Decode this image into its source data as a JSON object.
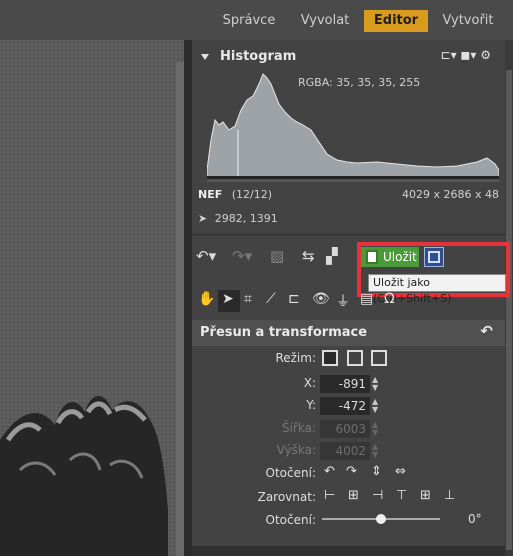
{
  "topnav": {
    "tabs": [
      {
        "label": "Správce"
      },
      {
        "label": "Vyvolat"
      },
      {
        "label": "Editor"
      },
      {
        "label": "Vytvořit"
      }
    ]
  },
  "histogram": {
    "title": "Histogram",
    "rgba": "RGBA:  35,  35,  35, 255"
  },
  "file": {
    "format": "NEF",
    "index": "(12/12)",
    "dimensions": "4029 x 2686 x 48",
    "cursor_pos": "2982, 1391"
  },
  "save": {
    "save_label": "Uložit",
    "tooltip": "Uložit jako (Ctrl+Shift+S)"
  },
  "section": {
    "title": "Přesun a transformace",
    "mode_label": "Režim:",
    "x_label": "X:",
    "x_value": "-891",
    "y_label": "Y:",
    "y_value": "-472",
    "width_label": "Šířka:",
    "width_value": "6003",
    "height_label": "Výška:",
    "height_value": "4002",
    "rotate_label": "Otočení:",
    "align_label": "Zarovnat:",
    "rotation_label": "Otočení:",
    "rotation_value": "0°",
    "rotation_slider": 0.5
  },
  "colors": {
    "accent": "#d99b1e",
    "save_green": "#4a9a3a",
    "highlight_red": "#e8323a"
  }
}
